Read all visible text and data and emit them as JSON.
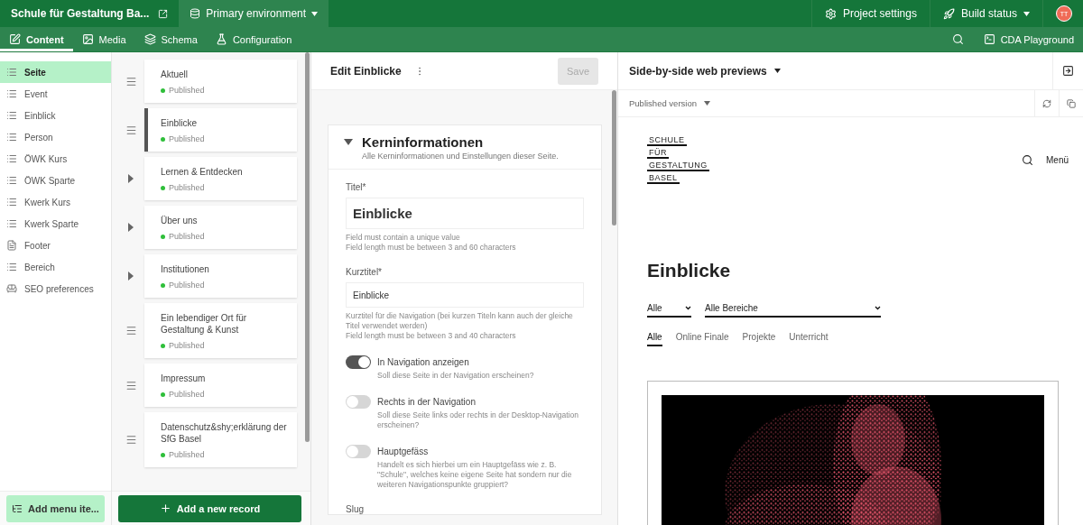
{
  "topbar": {
    "project": "Schule für Gestaltung Ba...",
    "environment": "Primary environment",
    "actions": [
      {
        "kind": "settings",
        "label": "Project settings"
      },
      {
        "kind": "build",
        "label": "Build status"
      }
    ],
    "avatar": "TT"
  },
  "navbar": {
    "tabs": [
      {
        "kind": "content",
        "label": "Content",
        "selected": true
      },
      {
        "kind": "media",
        "label": "Media",
        "selected": false
      },
      {
        "kind": "schema",
        "label": "Schema",
        "selected": false
      },
      {
        "kind": "config",
        "label": "Configuration",
        "selected": false
      }
    ],
    "playground": "CDA Playground"
  },
  "sidebar": {
    "items": [
      {
        "kind": "list",
        "label": "Seite",
        "selected": true
      },
      {
        "kind": "list",
        "label": "Event",
        "selected": false
      },
      {
        "kind": "list",
        "label": "Einblick",
        "selected": false
      },
      {
        "kind": "list",
        "label": "Person",
        "selected": false
      },
      {
        "kind": "list",
        "label": "ÖWK Kurs",
        "selected": false
      },
      {
        "kind": "list",
        "label": "ÖWK Sparte",
        "selected": false
      },
      {
        "kind": "list",
        "label": "Kwerk Kurs",
        "selected": false
      },
      {
        "kind": "list",
        "label": "Kwerk Sparte",
        "selected": false
      },
      {
        "kind": "single",
        "label": "Footer",
        "selected": false
      },
      {
        "kind": "list",
        "label": "Bereich",
        "selected": false
      },
      {
        "kind": "seo",
        "label": "SEO preferences",
        "selected": false
      }
    ],
    "add_button": "Add menu ite..."
  },
  "records": {
    "items": [
      {
        "kind": "leaf",
        "title": "Aktuell",
        "status": "Published",
        "selected": false
      },
      {
        "kind": "leaf",
        "title": "Einblicke",
        "status": "Published",
        "selected": true
      },
      {
        "kind": "folder",
        "title": "Lernen & Entdecken",
        "status": "Published",
        "selected": false
      },
      {
        "kind": "folder",
        "title": "Über uns",
        "status": "Published",
        "selected": false
      },
      {
        "kind": "folder",
        "title": "Institutionen",
        "status": "Published",
        "selected": false
      },
      {
        "kind": "leaf",
        "title": "Ein lebendiger Ort für Gestaltung & Kunst",
        "status": "Published",
        "selected": false
      },
      {
        "kind": "leaf",
        "title": "Impressum",
        "status": "Published",
        "selected": false
      },
      {
        "kind": "leaf",
        "title": "Datenschutz&shy;erklärung der SfG Basel",
        "status": "Published",
        "selected": false
      }
    ],
    "add_button": "Add a new record"
  },
  "editor": {
    "title": "Edit Einblicke",
    "save": {
      "label": "Save",
      "disabled": true
    },
    "section": {
      "title": "Kerninformationen",
      "subtitle": "Alle Kerninformationen und Einstellungen dieser Seite.",
      "expanded": true,
      "fields": [
        {
          "kind": "title",
          "label": "Titel*",
          "value": "Einblicke",
          "hints": [
            "Field must contain a unique value",
            "Field length must be between 3 and 60 characters"
          ]
        },
        {
          "kind": "text",
          "label": "Kurztitel*",
          "value": "Einblicke",
          "hints": [
            "Kurztitel für die Navigation (bei kurzen Titeln kann auch der gleiche Titel verwendet werden)",
            "Field length must be between 3 and 40 characters"
          ]
        },
        {
          "kind": "toggle",
          "label": "In Navigation anzeigen",
          "on": true,
          "hints": [
            "Soll diese Seite in der Navigation erscheinen?"
          ]
        },
        {
          "kind": "toggle",
          "label": "Rechts in der Navigation",
          "on": false,
          "hints": [
            "Soll diese Seite links oder rechts in der Desktop-Navigation erscheinen?"
          ]
        },
        {
          "kind": "toggle",
          "label": "Hauptgefäss",
          "on": false,
          "hints": [
            "Handelt es sich hierbei um ein Hauptgefäss wie z. B. \"Schule\", welches keine eigene Seite hat sondern nur die weiteren Navigationspunkte gruppiert?"
          ]
        },
        {
          "kind": "text",
          "label": "Slug"
        }
      ]
    }
  },
  "preview": {
    "title": "Side-by-side web previews",
    "version": "Published version",
    "site": {
      "logo": [
        "SCHULE",
        "FÜR",
        "GESTALTUNG",
        "BASEL"
      ],
      "menu": "Menü",
      "heading": "Einblicke",
      "filters": [
        "Alle",
        "Alle Bereiche"
      ],
      "tabs": [
        {
          "label": "Alle",
          "selected": true
        },
        {
          "label": "Online Finale",
          "selected": false
        },
        {
          "label": "Projekte",
          "selected": false
        },
        {
          "label": "Unterricht",
          "selected": false
        }
      ]
    }
  }
}
